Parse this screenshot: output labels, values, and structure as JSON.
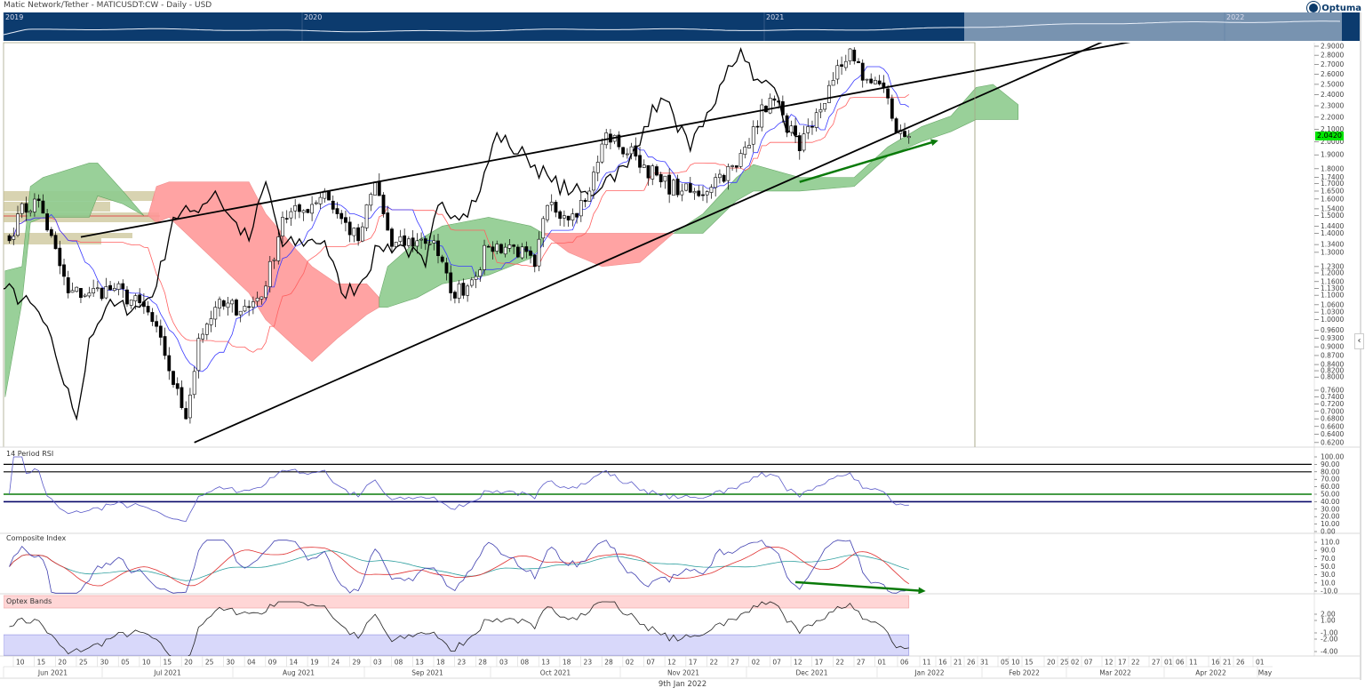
{
  "header": {
    "title": "Matic Network/Tether - MATICUSDT:CW - Daily - USD",
    "logo": "Optuma"
  },
  "overview": {
    "years": [
      "2019",
      "2020",
      "2021",
      "2022"
    ],
    "colors": {
      "dark": "#0c3b6e",
      "selection": "#7893b0"
    }
  },
  "price_tag": "2.0420",
  "footer_date": "9th Jan 2022",
  "collapse_icon": "chevron-left-icon",
  "panels": {
    "rsi": "14 Period RSI",
    "composite": "Composite Index",
    "optex": "Optex Bands"
  },
  "chart_data": {
    "type": "candlestick",
    "title": "Matic Network/Tether - MATICUSDT:CW - Daily - USD",
    "yscale": "log",
    "ylim": [
      0.62,
      2.9
    ],
    "y_ticks": [
      "2.9000",
      "2.8000",
      "2.7000",
      "2.6000",
      "2.5000",
      "2.4000",
      "2.3000",
      "2.2000",
      "2.1000",
      "2.0000",
      "1.9000",
      "1.8000",
      "1.7400",
      "1.7000",
      "1.6500",
      "1.6000",
      "1.5400",
      "1.5000",
      "1.4400",
      "1.4000",
      "1.3400",
      "1.3000",
      "1.2300",
      "1.2000",
      "1.1600",
      "1.1300",
      "1.1000",
      "1.0600",
      "1.0300",
      "1.0000",
      "0.9600",
      "0.9300",
      "0.9000",
      "0.8700",
      "0.8400",
      "0.8200",
      "0.8000",
      "0.7600",
      "0.7400",
      "0.7200",
      "0.7000",
      "0.6800",
      "0.6600",
      "0.6400",
      "0.6200"
    ],
    "x_day_ticks": [
      "10",
      "15",
      "20",
      "25",
      "30",
      "05",
      "10",
      "15",
      "20",
      "25",
      "30",
      "04",
      "09",
      "14",
      "19",
      "24",
      "29",
      "03",
      "08",
      "13",
      "18",
      "23",
      "28",
      "03",
      "08",
      "13",
      "18",
      "23",
      "28",
      "02",
      "07",
      "12",
      "17",
      "22",
      "27",
      "02",
      "07",
      "12",
      "17",
      "22",
      "27",
      "01",
      "06",
      "11",
      "16",
      "21",
      "26",
      "31",
      "05",
      "10",
      "15",
      "20",
      "25",
      "02",
      "07",
      "12",
      "17",
      "22",
      "27",
      "01",
      "06",
      "11",
      "16",
      "21",
      "26",
      "01"
    ],
    "x_month_ticks": [
      "Jun 2021",
      "Jul 2021",
      "Aug 2021",
      "Sep 2021",
      "Oct 2021",
      "Nov 2021",
      "Dec 2021",
      "Jan 2022",
      "Feb 2022",
      "Mar 2022",
      "Apr 2022",
      "May"
    ],
    "close_keypoints": [
      [
        "2021-06-08",
        1.36
      ],
      [
        "2021-06-10",
        1.51
      ],
      [
        "2021-06-15",
        1.59
      ],
      [
        "2021-06-22",
        1.11
      ],
      [
        "2021-06-27",
        1.11
      ],
      [
        "2021-07-03",
        1.13
      ],
      [
        "2021-07-11",
        1.03
      ],
      [
        "2021-07-15",
        0.87
      ],
      [
        "2021-07-19",
        0.71
      ],
      [
        "2021-07-20",
        0.68
      ],
      [
        "2021-07-23",
        0.93
      ],
      [
        "2021-07-27",
        1.05
      ],
      [
        "2021-08-04",
        1.05
      ],
      [
        "2021-08-08",
        1.14
      ],
      [
        "2021-08-12",
        1.49
      ],
      [
        "2021-08-17",
        1.53
      ],
      [
        "2021-08-22",
        1.65
      ],
      [
        "2021-08-25",
        1.51
      ],
      [
        "2021-08-30",
        1.36
      ],
      [
        "2021-09-03",
        1.71
      ],
      [
        "2021-09-07",
        1.33
      ],
      [
        "2021-09-13",
        1.36
      ],
      [
        "2021-09-17",
        1.36
      ],
      [
        "2021-09-21",
        1.11
      ],
      [
        "2021-09-25",
        1.14
      ],
      [
        "2021-09-30",
        1.33
      ],
      [
        "2021-10-06",
        1.33
      ],
      [
        "2021-10-11",
        1.23
      ],
      [
        "2021-10-14",
        1.56
      ],
      [
        "2021-10-20",
        1.51
      ],
      [
        "2021-10-24",
        1.65
      ],
      [
        "2021-10-28",
        2.07
      ],
      [
        "2021-10-31",
        1.96
      ],
      [
        "2021-11-04",
        1.89
      ],
      [
        "2021-11-10",
        1.71
      ],
      [
        "2021-11-15",
        1.65
      ],
      [
        "2021-11-19",
        1.62
      ],
      [
        "2021-11-23",
        1.74
      ],
      [
        "2021-11-28",
        1.81
      ],
      [
        "2021-12-02",
        2.12
      ],
      [
        "2021-12-06",
        2.37
      ],
      [
        "2021-12-09",
        2.22
      ],
      [
        "2021-12-13",
        1.93
      ],
      [
        "2021-12-16",
        2.12
      ],
      [
        "2021-12-21",
        2.54
      ],
      [
        "2021-12-25",
        2.87
      ],
      [
        "2021-12-28",
        2.54
      ],
      [
        "2021-12-31",
        2.54
      ],
      [
        "2022-01-03",
        2.37
      ],
      [
        "2022-01-05",
        2.07
      ],
      [
        "2022-01-08",
        2.042
      ]
    ],
    "ichimoku_cloud": [
      {
        "color": "green",
        "points": [
          [
            "2021-06-07",
            1.21,
            0.74
          ],
          [
            "2021-06-11",
            1.23,
            1.07
          ],
          [
            "2021-06-13",
            1.68,
            1.46
          ],
          [
            "2021-06-16",
            1.74,
            1.49
          ],
          [
            "2021-06-27",
            1.84,
            1.49
          ],
          [
            "2021-06-29",
            1.84,
            1.62
          ],
          [
            "2021-07-05",
            1.65,
            1.57
          ],
          [
            "2021-07-10",
            1.5,
            1.5
          ]
        ]
      },
      {
        "color": "red",
        "points": [
          [
            "2021-07-11",
            1.5,
            1.5
          ],
          [
            "2021-07-13",
            1.68,
            1.46
          ],
          [
            "2021-07-16",
            1.71,
            1.49
          ],
          [
            "2021-08-04",
            1.71,
            1.11
          ],
          [
            "2021-08-08",
            1.51,
            1.0
          ],
          [
            "2021-08-15",
            1.32,
            0.9
          ],
          [
            "2021-08-19",
            1.23,
            0.85
          ],
          [
            "2021-08-25",
            1.15,
            0.93
          ],
          [
            "2021-09-01",
            1.15,
            1.02
          ],
          [
            "2021-09-04",
            1.09,
            1.05
          ]
        ]
      },
      {
        "color": "green",
        "points": [
          [
            "2021-09-04",
            1.09,
            1.05
          ],
          [
            "2021-09-06",
            1.23,
            1.05
          ],
          [
            "2021-09-13",
            1.36,
            1.09
          ],
          [
            "2021-09-19",
            1.44,
            1.15
          ],
          [
            "2021-09-30",
            1.49,
            1.19
          ],
          [
            "2021-10-10",
            1.44,
            1.27
          ],
          [
            "2021-10-13",
            1.4,
            1.34
          ]
        ]
      },
      {
        "color": "red",
        "points": [
          [
            "2021-10-13",
            1.4,
            1.4
          ],
          [
            "2021-10-19",
            1.4,
            1.3
          ],
          [
            "2021-10-27",
            1.4,
            1.23
          ],
          [
            "2021-11-05",
            1.4,
            1.25
          ],
          [
            "2021-11-13",
            1.4,
            1.4
          ]
        ]
      },
      {
        "color": "green",
        "points": [
          [
            "2021-11-13",
            1.4,
            1.4
          ],
          [
            "2021-11-20",
            1.51,
            1.4
          ],
          [
            "2021-11-28",
            1.74,
            1.59
          ],
          [
            "2021-12-02",
            1.83,
            1.65
          ],
          [
            "2021-12-13",
            1.74,
            1.65
          ],
          [
            "2021-12-26",
            1.74,
            1.68
          ],
          [
            "2022-01-03",
            1.96,
            1.89
          ],
          [
            "2022-01-11",
            2.12,
            2.0
          ],
          [
            "2022-01-18",
            2.21,
            2.08
          ],
          [
            "2022-01-24",
            2.47,
            2.18
          ],
          [
            "2022-01-28",
            2.5,
            2.18
          ],
          [
            "2022-02-03",
            2.31,
            2.18
          ]
        ]
      }
    ],
    "trendlines": [
      {
        "name": "upper-trendline",
        "from": [
          "2021-06-25",
          1.38
        ],
        "to": [
          "2022-03-04",
          2.97
        ],
        "color": "#000000"
      },
      {
        "name": "lower-trendline",
        "from": [
          "2021-07-22",
          0.62
        ],
        "to": [
          "2022-02-24",
          2.97
        ],
        "color": "#000000"
      }
    ],
    "arrows": [
      {
        "panel": "price",
        "from": [
          "2021-12-13",
          1.71
        ],
        "to": [
          "2022-01-15",
          2.01
        ],
        "color": "#0a7a0a"
      },
      {
        "panel": "composite",
        "from": [
          "2021-12-12",
          12
        ],
        "to": [
          "2022-01-12",
          -10
        ],
        "color": "#0a7a0a"
      }
    ],
    "rsi": {
      "period": 14,
      "levels": [
        {
          "value": 90,
          "color": "#000000"
        },
        {
          "value": 80,
          "color": "#000000"
        },
        {
          "value": 50,
          "color": "#0a7a0a"
        },
        {
          "value": 40,
          "color": "#0a0a6a"
        }
      ],
      "ylim": [
        0,
        100
      ],
      "ticks": [
        "100.00",
        "90.00",
        "80.00",
        "70.00",
        "60.00",
        "50.00",
        "40.00",
        "30.00",
        "20.00",
        "10.00",
        "0.00"
      ]
    },
    "composite": {
      "ylim": [
        -10,
        110
      ],
      "ticks": [
        "110.0",
        "90.0",
        "70.0",
        "50.0",
        "30.0",
        "10.0",
        "-10.0"
      ]
    },
    "optex": {
      "overbought_band": [
        3,
        5
      ],
      "oversold_band": [
        -4.6,
        -1.3
      ],
      "ticks": [
        "2.00",
        "1.00",
        "-1.00",
        "-2.00",
        "-4.00"
      ]
    },
    "colors": {
      "up": "#ffffff",
      "down": "#000000",
      "tenkan": "#3a3aff",
      "kijun": "#ff6060",
      "lagging": "#000000",
      "cloud_green": "#8fcc8f",
      "cloud_red": "#ff9a9a"
    }
  }
}
